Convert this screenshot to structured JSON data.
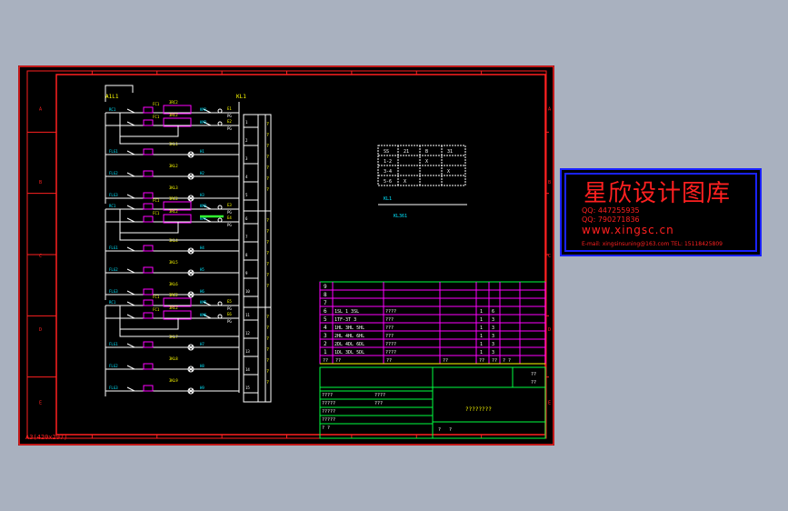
{
  "drawing": {
    "sheet_label": "A3(420x297)",
    "border_letters": [
      "A",
      "B",
      "C",
      "D",
      "E"
    ],
    "left_bus": "A1L1",
    "right_bus": "KL1",
    "circuit_groups": [
      {
        "rows": [
          {
            "left": "RC1",
            "mid1": "FC1",
            "mid2": "3RC2",
            "coil": "KM1",
            "tag": "E1"
          },
          {
            "left": "",
            "mid1": "FC1",
            "mid2": "3RC2",
            "coil": "KM2",
            "tag": "E2"
          },
          {
            "left": "FLG1",
            "mid1": "",
            "mid2": "3KL1",
            "coil": "H1",
            "tag": ""
          },
          {
            "left": "FLG2",
            "mid1": "",
            "mid2": "3KL2",
            "coil": "H2",
            "tag": ""
          },
          {
            "left": "FLG3",
            "mid1": "",
            "mid2": "3KL3",
            "coil": "H3",
            "tag": ""
          }
        ],
        "side_labels": [
          "1",
          "2",
          "3",
          "4",
          "5"
        ]
      },
      {
        "rows": [
          {
            "left": "RC1",
            "mid1": "FC1",
            "mid2": "3RC2",
            "coil": "KM3",
            "tag": "E3"
          },
          {
            "left": "",
            "mid1": "FC1",
            "mid2": "3RC2",
            "coil": "KM4",
            "tag": "E4"
          },
          {
            "left": "FLG1",
            "mid1": "",
            "mid2": "3KL4",
            "coil": "H4",
            "tag": ""
          },
          {
            "left": "FLG2",
            "mid1": "",
            "mid2": "3KL5",
            "coil": "H5",
            "tag": ""
          },
          {
            "left": "FLG3",
            "mid1": "",
            "mid2": "3KL6",
            "coil": "H6",
            "tag": ""
          }
        ],
        "side_labels": [
          "6",
          "7",
          "8",
          "9",
          "10"
        ]
      },
      {
        "rows": [
          {
            "left": "RC1",
            "mid1": "FC1",
            "mid2": "3RC2",
            "coil": "KM5",
            "tag": "E5"
          },
          {
            "left": "",
            "mid1": "FC1",
            "mid2": "3RC2",
            "coil": "KM6",
            "tag": "E6"
          },
          {
            "left": "FLG1",
            "mid1": "",
            "mid2": "3KL7",
            "coil": "H7",
            "tag": ""
          },
          {
            "left": "FLG2",
            "mid1": "",
            "mid2": "3KL8",
            "coil": "H8",
            "tag": ""
          },
          {
            "left": "FLG3",
            "mid1": "",
            "mid2": "3KL9",
            "coil": "H9",
            "tag": ""
          }
        ],
        "side_labels": [
          "11",
          "12",
          "13",
          "14",
          "15"
        ]
      }
    ],
    "switch_table": {
      "header": [
        "SS",
        "21",
        "B",
        "31"
      ],
      "rows": [
        [
          "1-2",
          "",
          "X",
          ""
        ],
        [
          "3-4",
          "",
          "",
          "X"
        ],
        [
          "5-6",
          "X",
          "",
          ""
        ]
      ],
      "caption": "KL1",
      "note": "KL361"
    },
    "bom": {
      "rows": [
        {
          "no": "9",
          "code": "",
          "name": "",
          "qty": "",
          "unit": ""
        },
        {
          "no": "8",
          "code": "",
          "name": "",
          "qty": "",
          "unit": ""
        },
        {
          "no": "7",
          "code": "",
          "name": "",
          "qty": "",
          "unit": ""
        },
        {
          "no": "6",
          "code": "1SL 1 3SL",
          "name": "????",
          "qty": "1",
          "unit": "6"
        },
        {
          "no": "5",
          "code": "1TF-3T 3",
          "name": "???",
          "qty": "1",
          "unit": "3"
        },
        {
          "no": "4",
          "code": "1HL 3HL 5HL",
          "name": "???",
          "qty": "1",
          "unit": "3"
        },
        {
          "no": "3",
          "code": "2HL 4HL 6HL",
          "name": "???",
          "qty": "1",
          "unit": "3"
        },
        {
          "no": "2",
          "code": "2DL 4DL 6DL",
          "name": "????",
          "qty": "1",
          "unit": "3"
        },
        {
          "no": "1",
          "code": "1DL 3DL 5DL",
          "name": "????",
          "qty": "1",
          "unit": "3"
        }
      ],
      "header": [
        "??",
        "??",
        "??",
        "??",
        "??",
        "??",
        "? ?"
      ],
      "extra": [
        "????",
        "???"
      ]
    },
    "title_block": {
      "title": "????????",
      "left_rows": [
        "????",
        "?????",
        "?????",
        "?????",
        "? ?"
      ],
      "side_rows": [
        "??",
        "??"
      ],
      "bottom": [
        "?",
        "?"
      ]
    }
  },
  "stamp": {
    "title": "星欣设计图库",
    "qq1": "QQ: 447255935",
    "qq2": "QQ: 790271836",
    "url": "www.xingsc.cn",
    "mail": "E-mail: xingsinsuning@163.com  TEL: 15118425809"
  },
  "colors": {
    "frame": "#ff2020",
    "wire": "#ffffff",
    "text": "#00e5ff",
    "label": "#ffff00",
    "component": "#ff00ff",
    "table": "#00ff40",
    "stamp_border": "#1a22ff"
  }
}
